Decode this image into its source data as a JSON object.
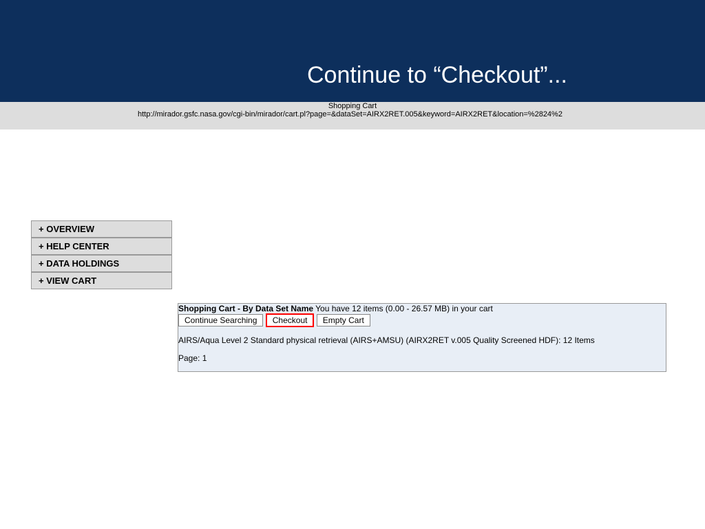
{
  "slide_title": "Continue to “Checkout”...",
  "window_title": "Shopping Cart",
  "url": "http://mirador.gsfc.nasa.gov/cgi-bin/mirador/cart.pl?page=&dataSet=AIRX2RET.005&keyword=AIRX2RET&location=%2824%2",
  "cart": {
    "title": "Shopping Cart - By Data Set Name",
    "summary": "You have 12 items (0.00 - 26.57 MB) in your cart",
    "continue": "Continue Searching",
    "checkout": "Checkout",
    "empty": "Empty Cart",
    "item": "AIRS/Aqua Level 2 Standard physical retrieval (AIRS+AMSU) (AIRX2RET v.005 Quality Screened HDF): 12 Items",
    "page": "Page: 1"
  },
  "sidebar": [
    "+ OVERVIEW",
    "+ HELP CENTER",
    "+ DATA HOLDINGS",
    "+ VIEW CART"
  ]
}
